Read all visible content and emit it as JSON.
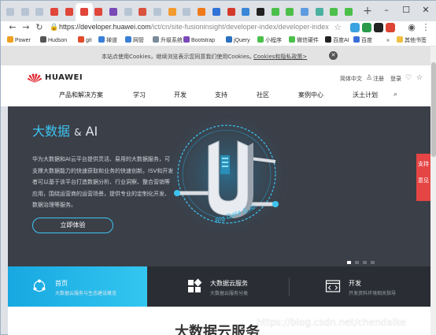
{
  "browser": {
    "tabs": [
      {
        "icon": "page-icon",
        "color": "#b7c4d4"
      },
      {
        "icon": "page-icon",
        "color": "#b7c4d4"
      },
      {
        "icon": "page-icon",
        "color": "#b7c4d4"
      },
      {
        "icon": "huawei-icon",
        "color": "#e0463a"
      },
      {
        "icon": "huawei-icon",
        "color": "#e0463a"
      },
      {
        "icon": "huawei-icon",
        "color": "#e0463a",
        "active": true
      },
      {
        "icon": "huawei-icon",
        "color": "#e0463a"
      },
      {
        "icon": "media-icon",
        "color": "#7a4ab8"
      },
      {
        "icon": "page-icon",
        "color": "#b7c4d4"
      },
      {
        "icon": "pdf-icon",
        "color": "#d9533f"
      },
      {
        "icon": "page-icon",
        "color": "#b7c4d4"
      },
      {
        "icon": "translate-icon",
        "color": "#f29b2e"
      },
      {
        "icon": "page-icon",
        "color": "#b7c4d4"
      },
      {
        "icon": "orange-icon",
        "color": "#f07a1a"
      },
      {
        "icon": "paw-icon",
        "color": "#3072d8"
      },
      {
        "icon": "csdn-icon",
        "color": "#d43a2a"
      },
      {
        "icon": "blue-icon",
        "color": "#3a86d9"
      },
      {
        "icon": "ai-icon",
        "color": "#222222"
      },
      {
        "icon": "chat-icon",
        "color": "#4bbf4a"
      },
      {
        "icon": "chat-icon",
        "color": "#4bbf4a"
      },
      {
        "icon": "image-icon",
        "color": "#5e9be0"
      },
      {
        "icon": "mail-icon",
        "color": "#4ab0a0"
      },
      {
        "icon": "chat-icon",
        "color": "#4bbf4a"
      },
      {
        "icon": "chat-icon",
        "color": "#4bbf4a"
      }
    ],
    "new_tab": "+",
    "window_controls": {
      "minimize": "–",
      "maximize": "☐",
      "close": "✕"
    },
    "url_host": "https://developer.huawei.com",
    "url_path": "/ict/cn/site-fusioninsight/developer-index/developer-index",
    "bookmarks": [
      {
        "label": "Power",
        "color": "#f0a020"
      },
      {
        "label": "Hudson",
        "color": "#555555"
      },
      {
        "label": "git",
        "color": "#e24a2a"
      },
      {
        "label": "禅道",
        "color": "#3a7fd5"
      },
      {
        "label": "网管",
        "color": "#3a7fd5"
      },
      {
        "label": "升级系统",
        "color": "#7a8a99"
      },
      {
        "label": "Bootstrap",
        "color": "#7a4ab8"
      },
      {
        "label": "jQuery",
        "color": "#2a70c0"
      },
      {
        "label": "小程序",
        "color": "#4bbf4a"
      },
      {
        "label": "微信硬件",
        "color": "#4bbf4a"
      },
      {
        "label": "百度AI",
        "color": "#222222"
      },
      {
        "label": "百度",
        "color": "#3a6fd8"
      },
      {
        "label": "»",
        "color": ""
      },
      {
        "label": "其他书签",
        "color": "#f0c040"
      }
    ]
  },
  "cookie_bar": {
    "text": "本站点使用Cookies，继续浏览表示您同意我们使用Cookies。",
    "link": "Cookies和隐私政策>",
    "close": "✕"
  },
  "header": {
    "brand": "HUAWEI",
    "lang": "简体中文",
    "register": "注册",
    "login": "登录",
    "nav": [
      "产品和解决方案",
      "学习",
      "开发",
      "支持",
      "社区",
      "案例中心",
      "沃土计划"
    ]
  },
  "banner": {
    "title_cn": "大数据",
    "title_amp": "&",
    "title_ai": "AI",
    "description": "华为大数据和AI云平台提供灵活、易用的大数据服务，可支撑大数据能力的快速获取和业务的快速创新。ISV和开发者可以基于该平台打造数据分析、行业洞察、整合营销等应用，围绕运营商的运营场景，提供专业的定制化开发、数据治理等服务。",
    "cta": "立即体验",
    "art_text": "Big Data & AI",
    "slides_total": 4,
    "slide_active": 1
  },
  "float_tab": {
    "line1": "支持",
    "line2": "意见"
  },
  "tiles": [
    {
      "title": "首页",
      "sub": "大数据云服务与生态建设概览",
      "icon": "network-icon"
    },
    {
      "title": "大数据云服务",
      "sub": "大数据云服务分类",
      "icon": "grid-icon"
    },
    {
      "title": "开发",
      "sub": "开发资料环境相关指导",
      "icon": "code-icon"
    }
  ],
  "below_title": "大数据云服务",
  "watermark": "https://blog.csdn.net/chendaike"
}
